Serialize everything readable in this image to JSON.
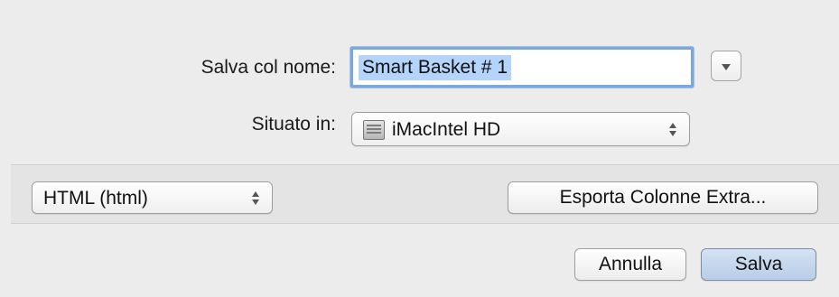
{
  "dialog": {
    "save_as_label": "Salva col nome:",
    "save_as_value": "Smart Basket # 1",
    "location_label": "Situato in:",
    "location_value": "iMacIntel HD",
    "location_icon": "hard-drive-icon",
    "format_value": "HTML (html)",
    "export_columns_label": "Esporta Colonne Extra...",
    "cancel_label": "Annulla",
    "save_label": "Salva"
  },
  "colors": {
    "dialog_bg": "#ececec",
    "selection_highlight": "#b4d4fb",
    "focus_ring": "#7aa7dc",
    "default_button": "#b8cde6"
  }
}
